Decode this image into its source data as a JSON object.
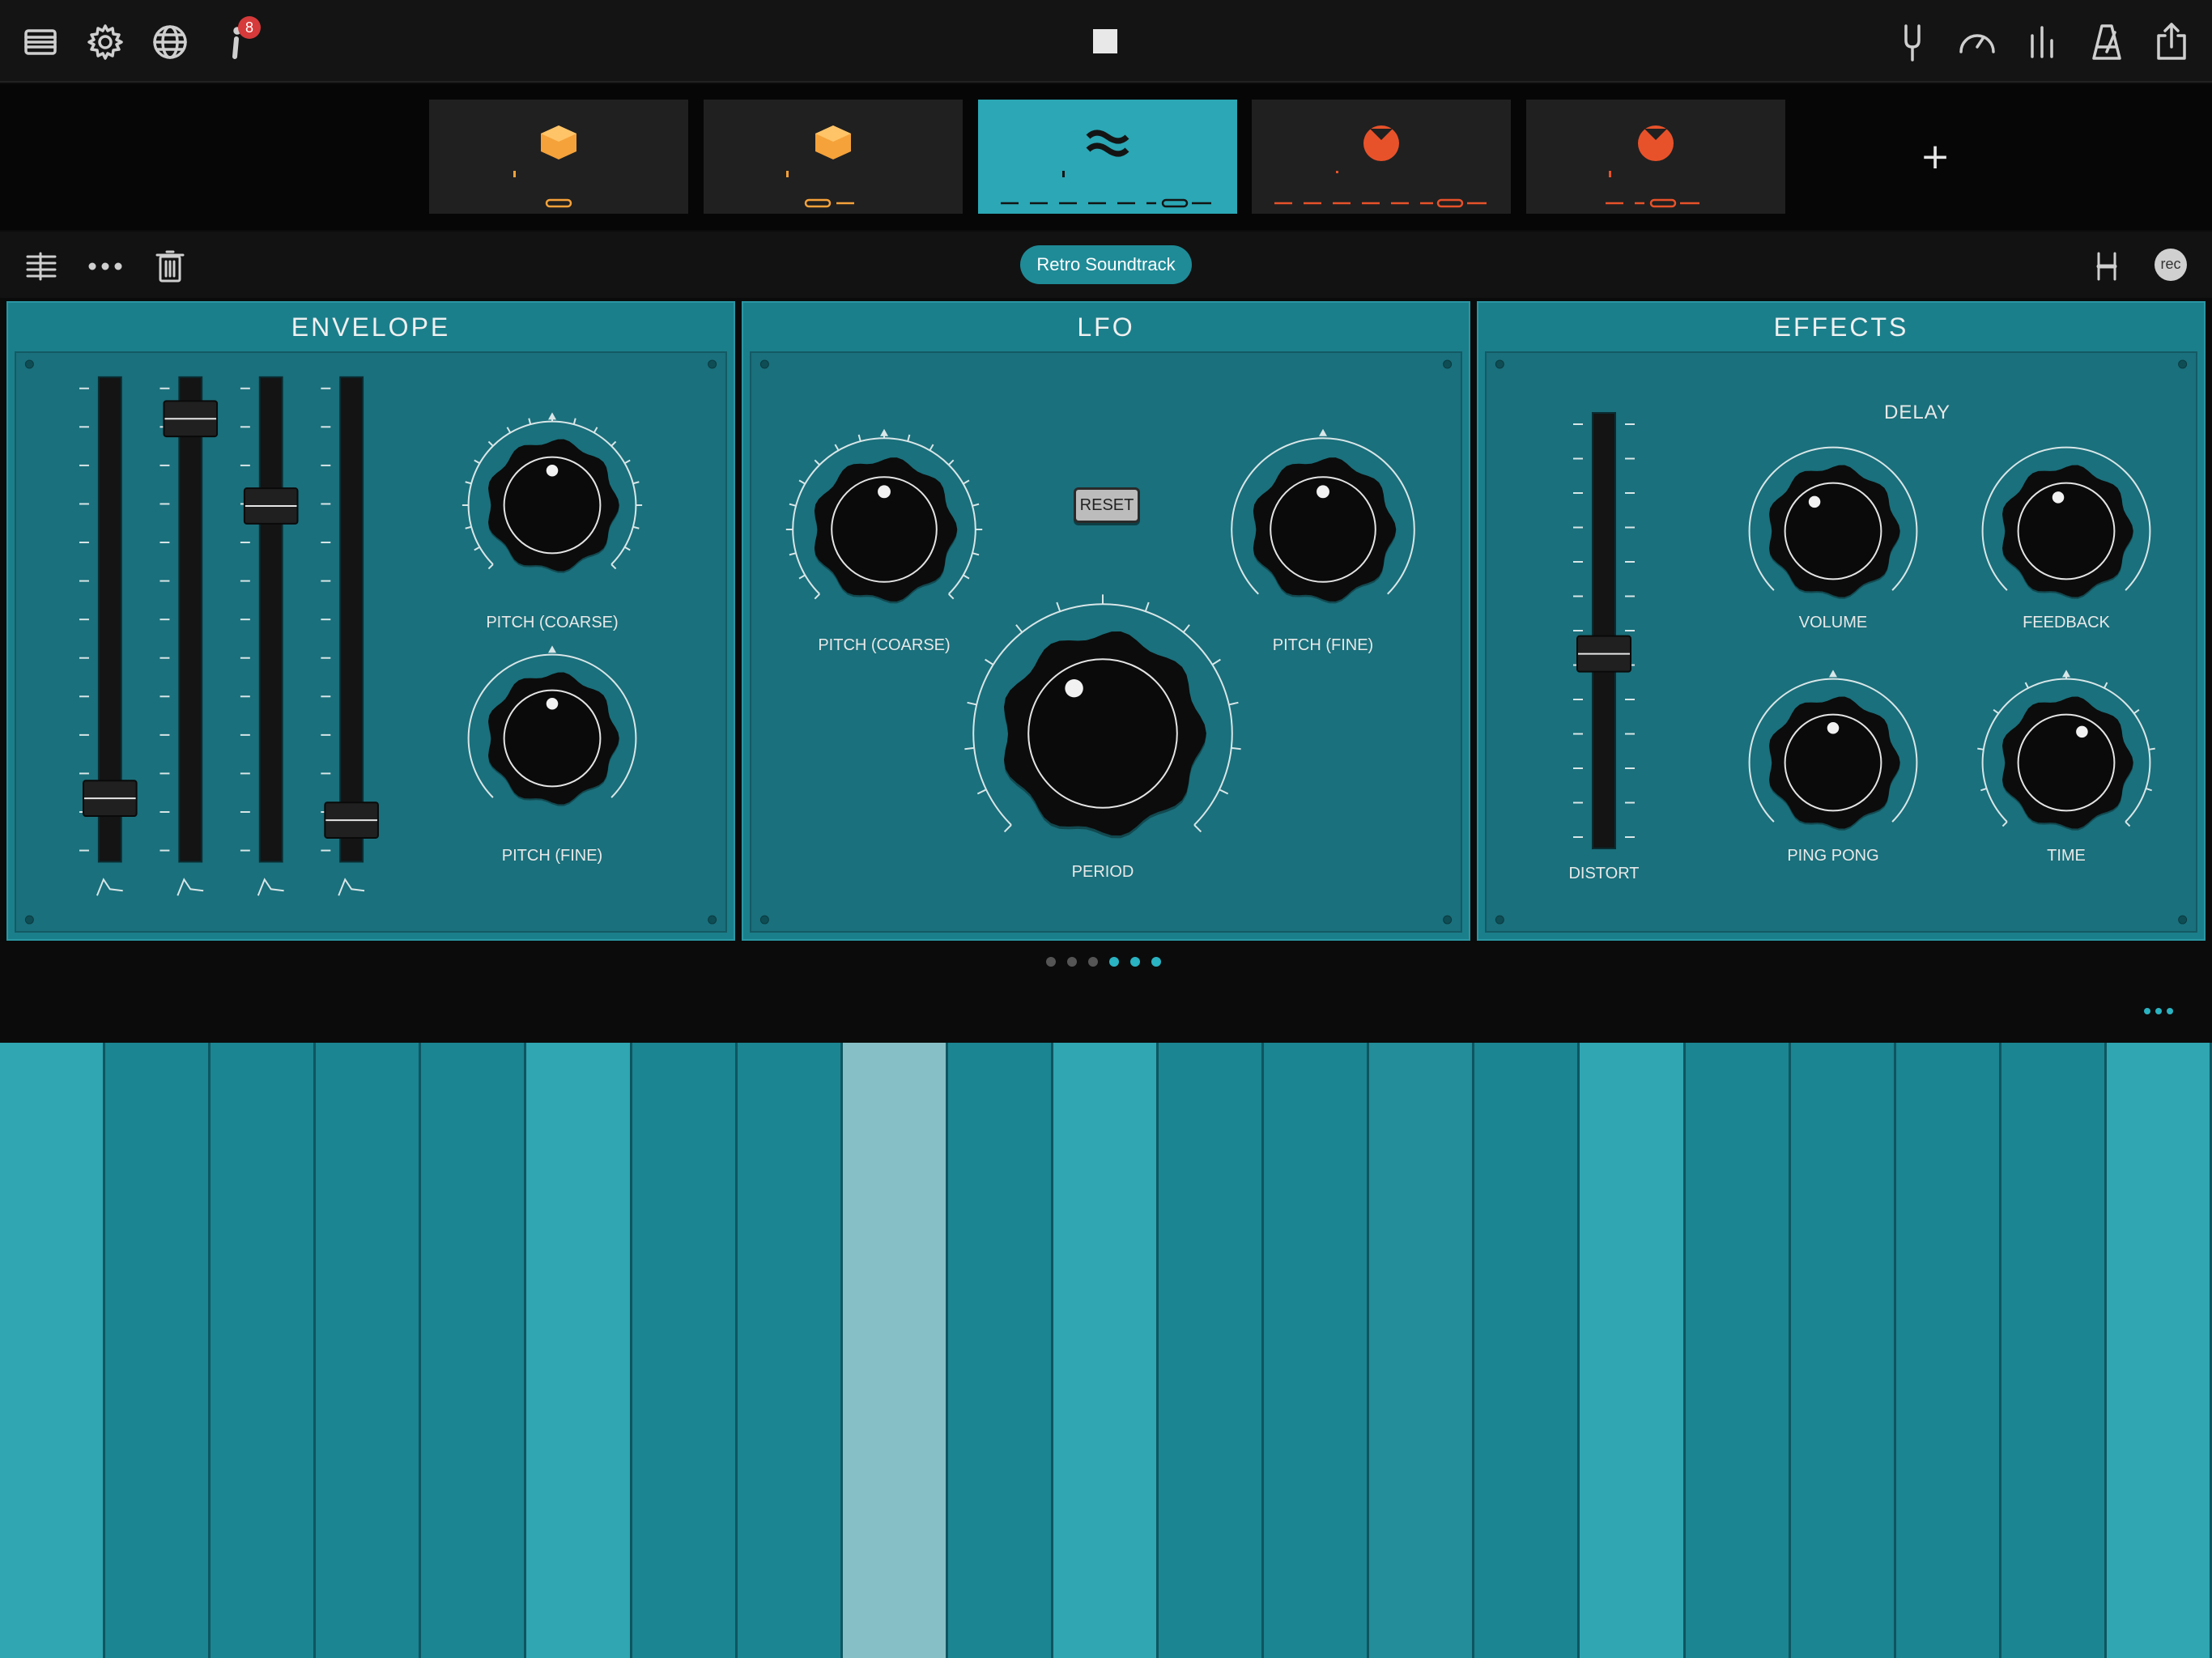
{
  "topbar": {
    "left_icons": [
      "library-icon",
      "gear-icon",
      "globe-icon",
      "info-icon"
    ],
    "info_badge": "8",
    "transport": "stop-icon",
    "right_icons": [
      "tuning-fork-icon",
      "speedometer-icon",
      "mixer-icon",
      "metronome-icon",
      "share-icon"
    ]
  },
  "tracks": [
    {
      "icon": "cube-icon",
      "color": "#f5a23a",
      "active": false
    },
    {
      "icon": "cube-icon",
      "color": "#f5a23a",
      "active": false
    },
    {
      "icon": "wave-icon",
      "color": "#1a1a1a",
      "active": true
    },
    {
      "icon": "drum-icon",
      "color": "#e8522a",
      "active": false
    },
    {
      "icon": "drum-icon",
      "color": "#e8522a",
      "active": false
    }
  ],
  "add_track_label": "+",
  "presetbar": {
    "preset_name": "Retro Soundtrack",
    "rec_label": "rec",
    "icons": [
      "tracks-list-icon",
      "more-icon",
      "trash-icon",
      "split-icon"
    ]
  },
  "envelope": {
    "title": "ENVELOPE",
    "sliders": [
      {
        "name": "attack",
        "value": 0.09
      },
      {
        "name": "decay",
        "value": 0.96
      },
      {
        "name": "sustain",
        "value": 0.76
      },
      {
        "name": "release",
        "value": 0.04
      }
    ],
    "pitch_coarse_label": "PITCH (COARSE)",
    "pitch_fine_label": "PITCH (FINE)",
    "pitch_coarse_value": 0.5,
    "pitch_fine_value": 0.5
  },
  "lfo": {
    "title": "LFO",
    "reset_label": "RESET",
    "pitch_coarse_label": "PITCH (COARSE)",
    "pitch_fine_label": "PITCH (FINE)",
    "period_label": "PERIOD",
    "pitch_coarse_value": 0.5,
    "pitch_fine_value": 0.5,
    "period_value": 0.38
  },
  "effects": {
    "title": "EFFECTS",
    "delay_label": "DELAY",
    "distort_label": "DISTORT",
    "distort_value": 0.44,
    "volume_label": "VOLUME",
    "feedback_label": "FEEDBACK",
    "ping_pong_label": "PING PONG",
    "time_label": "TIME",
    "volume_value": 0.38,
    "feedback_value": 0.45,
    "ping_pong_value": 0.5,
    "time_value": 0.6
  },
  "pages": {
    "count": 6,
    "active": [
      3,
      4,
      5
    ]
  },
  "pads": {
    "count": 21,
    "colors": [
      "#2fa6b2",
      "#1b8591",
      "#1b8591",
      "#1b8591",
      "#1b8591",
      "#2fa6b2",
      "#1b8591",
      "#1b8591",
      "#86bfc5",
      "#1b8591",
      "#2fa6b2",
      "#1b8591",
      "#1b8591",
      "#238d99",
      "#1b8591",
      "#2fa6b2",
      "#1b8591",
      "#1b8591",
      "#1b8591",
      "#1b8591",
      "#2fa6b2"
    ]
  }
}
